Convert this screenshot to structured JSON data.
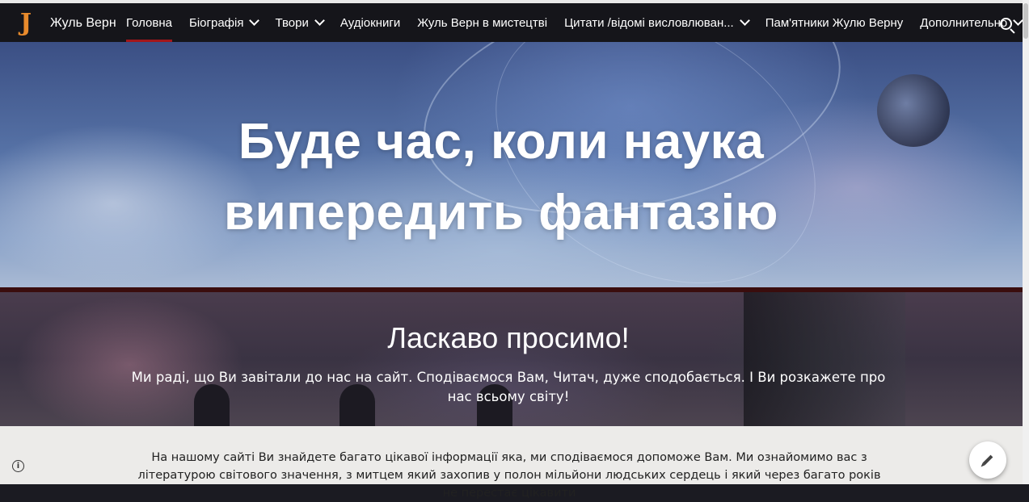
{
  "nav": {
    "logo_letter": "J",
    "site_title": "Жуль Верн",
    "items": [
      {
        "label": "Головна",
        "dropdown": false,
        "active": true
      },
      {
        "label": "Біографія",
        "dropdown": true,
        "active": false
      },
      {
        "label": "Твори",
        "dropdown": true,
        "active": false
      },
      {
        "label": "Аудіокниги",
        "dropdown": false,
        "active": false
      },
      {
        "label": "Жуль Верн в мистецтві",
        "dropdown": false,
        "active": false
      },
      {
        "label": "Цитати /відомі висловлюван...",
        "dropdown": true,
        "active": false
      },
      {
        "label": "Пам'ятники Жулю Верну",
        "dropdown": false,
        "active": false
      },
      {
        "label": "Дополнительно",
        "dropdown": true,
        "active": false
      }
    ],
    "search_icon": "search-icon",
    "accent_color": "#a3161a"
  },
  "hero": {
    "title_line1": "Буде час, коли наука",
    "title_line2": "випередить фантазію"
  },
  "welcome": {
    "title": "Ласкаво просимо!",
    "text": "Ми раді, що Ви завітали до нас на сайт. Сподіваємося Вам, Читач, дуже сподобається. І Ви розкажете про нас всьому світу!"
  },
  "content": {
    "text": "На нашому сайті Ви знайдете багато цікавої інформації яка, ми сподіваємося допоможе Вам. Ми ознайомимо вас з літературою світового значення, з митцем який захопив у  полон мільйони людських сердець і який через багато років не перестає цікавити"
  },
  "footer": {
    "info_icon": "info-icon",
    "info_glyph": "i",
    "edit_icon": "pencil-icon"
  }
}
